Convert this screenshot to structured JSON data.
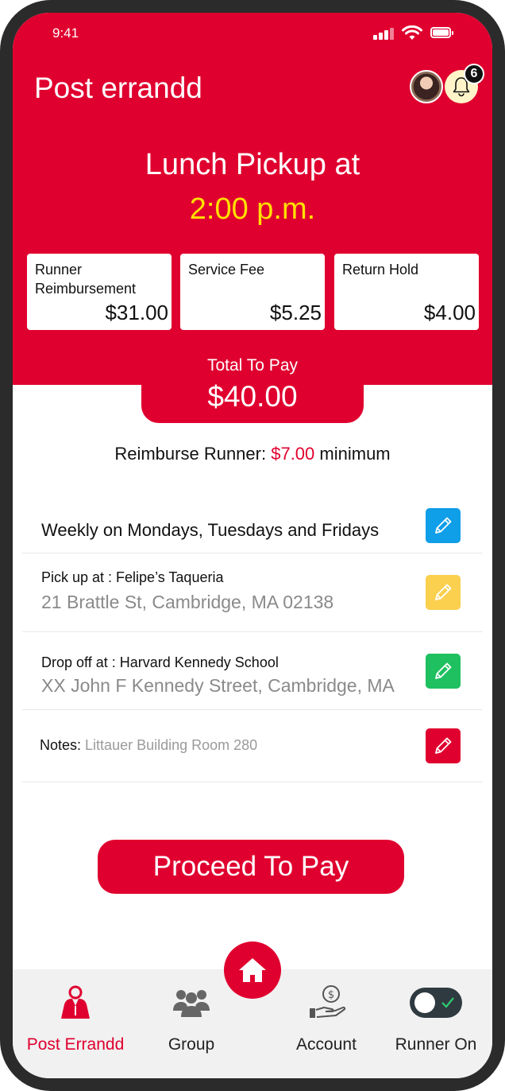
{
  "status": {
    "time": "9:41"
  },
  "header": {
    "title": "Post errandd",
    "notification_count": "6"
  },
  "errand": {
    "title": "Lunch Pickup at",
    "time": "2:00 p.m."
  },
  "fees": [
    {
      "label": "Runner Reimbursement",
      "value": "$31.00"
    },
    {
      "label": "Service Fee",
      "value": "$5.25"
    },
    {
      "label": "Return Hold",
      "value": "$4.00"
    }
  ],
  "total": {
    "label": "Total To Pay",
    "value": "$40.00"
  },
  "reimburse": {
    "prefix": "Reimburse Runner:",
    "amount": "$7.00",
    "suffix": "minimum"
  },
  "schedule": {
    "text": "Weekly on Mondays, Tuesdays and Fridays"
  },
  "pickup": {
    "label": "Pick up at :  Felipe’s Taqueria",
    "address": "21 Brattle St, Cambridge, MA 02138"
  },
  "dropoff": {
    "label": "Drop off at :  Harvard Kennedy School",
    "address": "XX John F Kennedy Street, Cambridge, MA"
  },
  "notes": {
    "label": "Notes:",
    "value": "Littauer Building Room 280"
  },
  "actions": {
    "pay_label": "Proceed To Pay"
  },
  "tabs": [
    {
      "label": "Post Errandd",
      "icon": "person-pray-icon"
    },
    {
      "label": "Group",
      "icon": "group-icon"
    },
    {
      "label": "Account",
      "icon": "hand-coin-icon"
    },
    {
      "label": "Runner On",
      "icon": "toggle-icon"
    }
  ],
  "colors": {
    "brand_red": "#e0002f",
    "highlight_yellow": "#ffe000",
    "edit_blue": "#0f9ee8",
    "edit_yellow": "#fbd04f",
    "edit_green": "#1ec060",
    "edit_red": "#e0002f"
  }
}
